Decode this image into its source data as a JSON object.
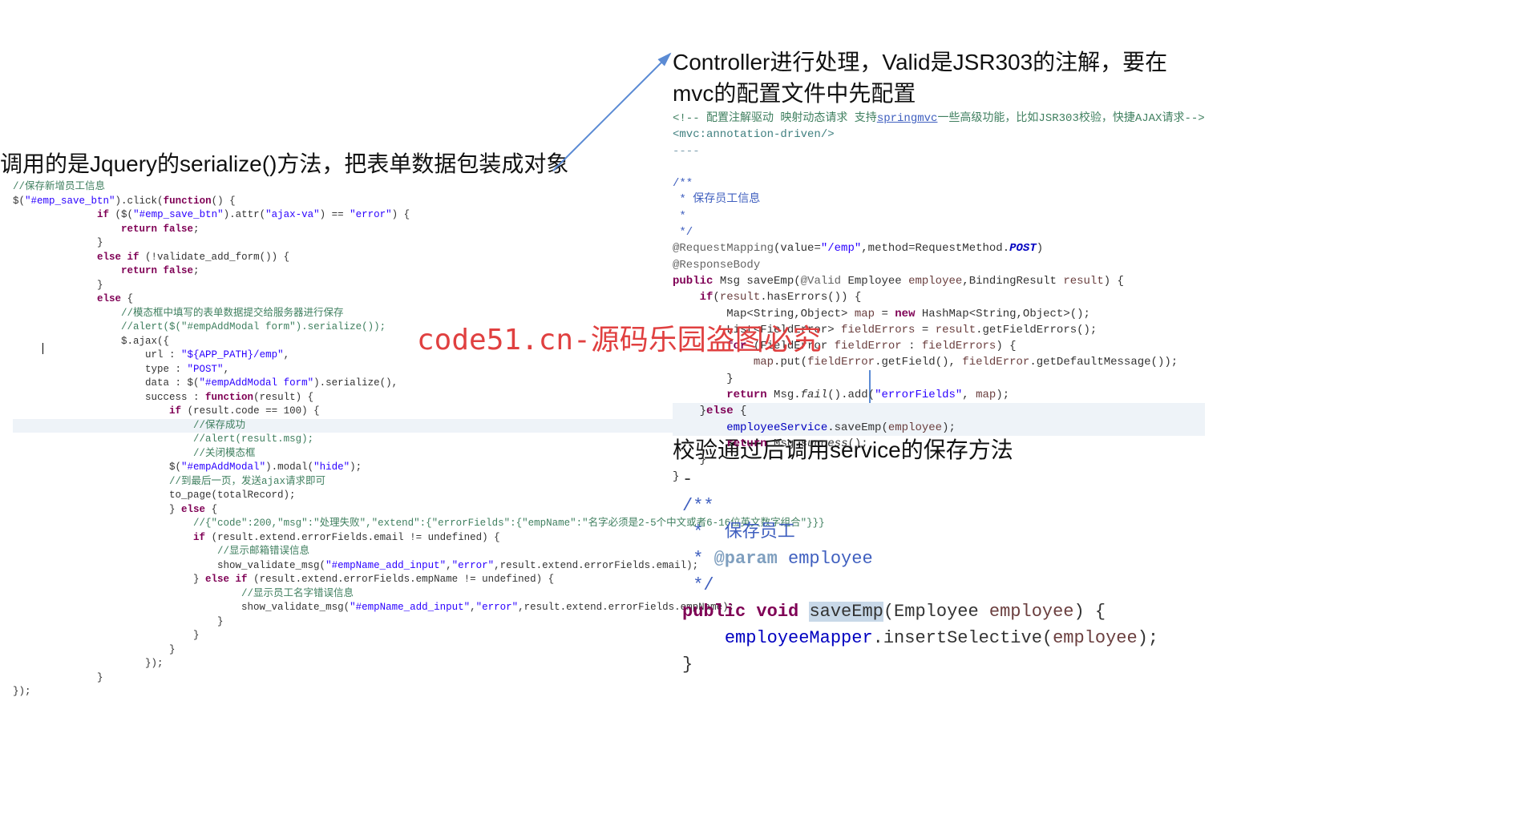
{
  "headings": {
    "left": "调用的是Jquery的serialize()方法，把表单数据包装成对象",
    "right_top": "Controller进行处理，Valid是JSR303的注解，要在mvc的配置文件中先配置",
    "right_bottom": "校验通过后调用service的保存方法"
  },
  "watermark": "code51.cn-源码乐园盗图必究",
  "code_left_lines": [
    {
      "t": "//保存新增员工信息",
      "cls": "c-comment"
    },
    {
      "raw": "$(<span class='c-str'>\"#emp_save_btn\"</span>).click(<span class='c-brown'>function</span>() {"
    },
    {
      "indent": 1,
      "raw": "<span class='c-brown'>if</span> ($(<span class='c-str'>\"#emp_save_btn\"</span>).attr(<span class='c-str'>\"ajax-va\"</span>) == <span class='c-str'>\"error\"</span>) {"
    },
    {
      "indent": 2,
      "raw": "<span class='c-brown'>return false</span>;"
    },
    {
      "indent": 1,
      "raw": "}"
    },
    {
      "indent": 1,
      "raw": "<span class='c-brown'>else if</span> (!validate_add_form()) {"
    },
    {
      "indent": 2,
      "raw": "<span class='c-brown'>return false</span>;"
    },
    {
      "indent": 1,
      "raw": "}"
    },
    {
      "indent": 1,
      "raw": "<span class='c-brown'>else</span> {"
    },
    {
      "indent": 2,
      "t": "//模态框中填写的表单数据提交给服务器进行保存",
      "cls": "c-comment"
    },
    {
      "indent": 2,
      "t": "//alert($(\"#empAddModal form\").serialize());",
      "cls": "c-comment"
    },
    {
      "indent": 2,
      "raw": "$.ajax({"
    },
    {
      "indent": 3,
      "raw": "url : <span class='c-str'>\"${APP_PATH}/emp\"</span>,"
    },
    {
      "indent": 3,
      "raw": "type : <span class='c-str'>\"POST\"</span>,"
    },
    {
      "indent": 3,
      "raw": "data : $(<span class='c-str'>\"#empAddModal form\"</span>).serialize(),"
    },
    {
      "indent": 3,
      "raw": "success : <span class='c-brown'>function</span>(result) {"
    },
    {
      "indent": 4,
      "raw": "<span class='c-brown'>if</span> (result.code == 100) {"
    },
    {
      "indent": 5,
      "t": "//保存成功",
      "cls": "c-comment",
      "hl": true
    },
    {
      "indent": 5,
      "t": "//alert(result.msg);",
      "cls": "c-comment"
    },
    {
      "indent": 5,
      "t": "//关闭模态框",
      "cls": "c-comment"
    },
    {
      "indent": 4,
      "raw": "$(<span class='c-str'>\"#empAddModal\"</span>).modal(<span class='c-str'>\"hide\"</span>);"
    },
    {
      "indent": 4,
      "t": "//到最后一页，发送ajax请求即可",
      "cls": "c-comment"
    },
    {
      "indent": 4,
      "raw": "to_page(totalRecord);"
    },
    {
      "indent": 4,
      "raw": "} <span class='c-brown'>else</span> {"
    },
    {
      "indent": 5,
      "t": "//{\"code\":200,\"msg\":\"处理失败\",\"extend\":{\"errorFields\":{\"empName\":\"名字必须是2-5个中文或者6-16位英文数字组合\"}}}",
      "cls": "c-comment"
    },
    {
      "indent": 5,
      "raw": "<span class='c-brown'>if</span> (result.extend.errorFields.email != undefined) {"
    },
    {
      "indent": 6,
      "t": "//显示邮箱错误信息",
      "cls": "c-comment"
    },
    {
      "indent": 6,
      "raw": "show_validate_msg(<span class='c-str'>\"#empName_add_input\"</span>,<span class='c-str'>\"error\"</span>,result.extend.errorFields.email);"
    },
    {
      "indent": 5,
      "raw": "} <span class='c-brown'>else if</span> (result.extend.errorFields.empName != undefined) {"
    },
    {
      "indent": 7,
      "t": "//显示员工名字错误信息",
      "cls": "c-comment"
    },
    {
      "indent": 7,
      "raw": "show_validate_msg(<span class='c-str'>\"#empName_add_input\"</span>,<span class='c-str'>\"error\"</span>,result.extend.errorFields.empName);"
    },
    {
      "indent": 6,
      "raw": "}"
    },
    {
      "indent": 5,
      "raw": "}"
    },
    {
      "indent": 4,
      "raw": "}"
    },
    {
      "indent": 3,
      "raw": "});"
    },
    {
      "indent": 1,
      "raw": "}"
    },
    {
      "indent": 0,
      "raw": "});"
    }
  ],
  "code_right_top_lines": [
    {
      "raw": "<span class='c-green'>&lt;!-- 配置注解驱动 映射动态请求 支持</span><span style='color:#3f5fbf;text-decoration:underline'>springmvc</span><span class='c-green'>一些高级功能，比如JSR303校验，快捷AJAX请求--&gt;</span>"
    },
    {
      "raw": "<span style='color:#3f7f7f'>&lt;mvc:annotation-driven/&gt;</span>"
    },
    {
      "raw": "<span class='c-comment2'>----</span>"
    },
    {
      "raw": "&nbsp;"
    },
    {
      "raw": "<span class='c-docblue'>/**</span>"
    },
    {
      "raw": "<span class='c-docblue'> * 保存员工信息</span>"
    },
    {
      "raw": "<span class='c-docblue'> *</span>"
    },
    {
      "raw": "<span class='c-docblue'> */</span>"
    },
    {
      "raw": "<span class='c-gray'>@RequestMapping</span>(value=<span class='c-str'>\"/emp\"</span>,method=RequestMethod.<span class='c-post'>POST</span>)"
    },
    {
      "raw": "<span class='c-gray'>@ResponseBody</span>"
    },
    {
      "raw": "<span class='c-key'>public</span> Msg saveEmp(<span class='c-gray'>@Valid</span> Employee <span class='c-param'>employee</span>,BindingResult <span class='c-param'>result</span>) {"
    },
    {
      "raw": "    <span class='c-key'>if</span>(<span class='c-param'>result</span>.hasErrors()) {"
    },
    {
      "raw": "        Map&lt;String,Object&gt; <span class='c-param'>map</span> = <span class='c-key'>new</span> HashMap&lt;String,Object&gt;();"
    },
    {
      "raw": "        List&lt;FieldError&gt; <span class='c-param'>fieldErrors</span> = <span class='c-param'>result</span>.getFieldErrors();"
    },
    {
      "raw": "        <span class='c-key'>for</span> (FieldError <span class='c-param'>fieldError</span> : <span class='c-param'>fieldErrors</span>) {"
    },
    {
      "raw": "            <span class='c-param'>map</span>.put(<span class='c-param'>fieldError</span>.getField(), <span class='c-param'>fieldError</span>.getDefaultMessage());"
    },
    {
      "raw": "        }"
    },
    {
      "raw": "        <span class='c-key'>return</span> Msg.<span class='c-success'>fail</span>().add(<span class='c-str'>\"errorFields\"</span>, <span class='c-param'>map</span>);"
    },
    {
      "raw": "    }<span class='c-key'>else</span> {",
      "hl": true
    },
    {
      "raw": "        <span class='c-field'>employeeService</span>.saveEmp(<span class='c-param'>employee</span>);",
      "hl": true
    },
    {
      "raw": "        <span class='c-key'>return</span> Msg.<span style='font-style:italic'>success</span>();"
    },
    {
      "raw": "    }"
    },
    {
      "raw": "}"
    }
  ],
  "code_right_bottom_lines": [
    {
      "raw": "<span style='color:#333'>-</span>"
    },
    {
      "raw": "<span class='c-docblue'>/**</span>"
    },
    {
      "raw": "<span class='c-docblue'> *  保存员工</span>"
    },
    {
      "raw": "<span class='c-docblue'> * </span><span class='c-doctag'>@param</span><span class='c-docblue'> employee</span>"
    },
    {
      "raw": "<span class='c-docblue'> */</span>"
    },
    {
      "raw": "<span class='c-key'>public</span> <span class='c-key'>void</span> <span class='hl-sel'>saveEmp</span>(Employee <span class='c-param'>employee</span>) {"
    },
    {
      "raw": "    <span class='c-field'>employeeMapper</span>.insertSelective(<span class='c-param'>employee</span>);"
    },
    {
      "raw": "}"
    }
  ]
}
